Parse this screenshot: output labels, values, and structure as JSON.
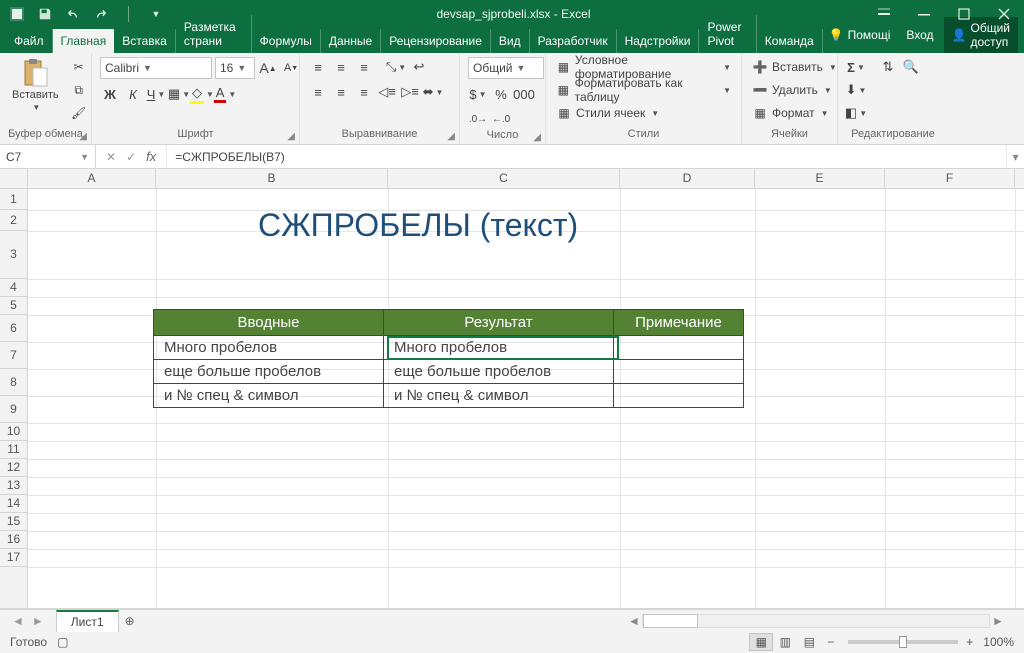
{
  "titlebar": {
    "title": "devsap_sjprobeli.xlsx - Excel"
  },
  "tabs": {
    "items": [
      "Файл",
      "Главная",
      "Вставка",
      "Разметка страни",
      "Формулы",
      "Данные",
      "Рецензирование",
      "Вид",
      "Разработчик",
      "Надстройки",
      "Power Pivot",
      "Команда"
    ],
    "active_index": 1,
    "help": "Помощі",
    "login": "Вход",
    "share": "Общий доступ"
  },
  "ribbon": {
    "clipboard": {
      "paste": "Вставить",
      "label": "Буфер обмена"
    },
    "font": {
      "name": "Calibri",
      "size": "16",
      "bold": "Ж",
      "italic": "К",
      "underline": "Ч",
      "label": "Шрифт"
    },
    "align": {
      "label": "Выравнивание"
    },
    "number": {
      "format": "Общий",
      "label": "Число"
    },
    "styles": {
      "cond": "Условное форматирование",
      "table": "Форматировать как таблицу",
      "cell": "Стили ячеек",
      "label": "Стили"
    },
    "cells": {
      "insert": "Вставить",
      "delete": "Удалить",
      "format": "Формат",
      "label": "Ячейки"
    },
    "editing": {
      "label": "Редактирование"
    }
  },
  "fbar": {
    "name": "C7",
    "formula": "=СЖПРОБЕЛЫ(B7)"
  },
  "grid": {
    "cols": [
      "A",
      "B",
      "C",
      "D",
      "E",
      "F"
    ],
    "title": "СЖПРОБЕЛЫ (текст)",
    "headers": [
      "Вводные",
      "Результат",
      "Примечание"
    ],
    "rows": [
      [
        "Много     пробелов",
        "Много пробелов",
        ""
      ],
      [
        "еще   больше   пробелов",
        "еще больше пробелов",
        ""
      ],
      [
        "  и    № спец   &   символ",
        "и № спец & символ",
        ""
      ]
    ]
  },
  "sheets": {
    "tab": "Лист1"
  },
  "status": {
    "ready": "Готово",
    "zoom": "100%"
  }
}
